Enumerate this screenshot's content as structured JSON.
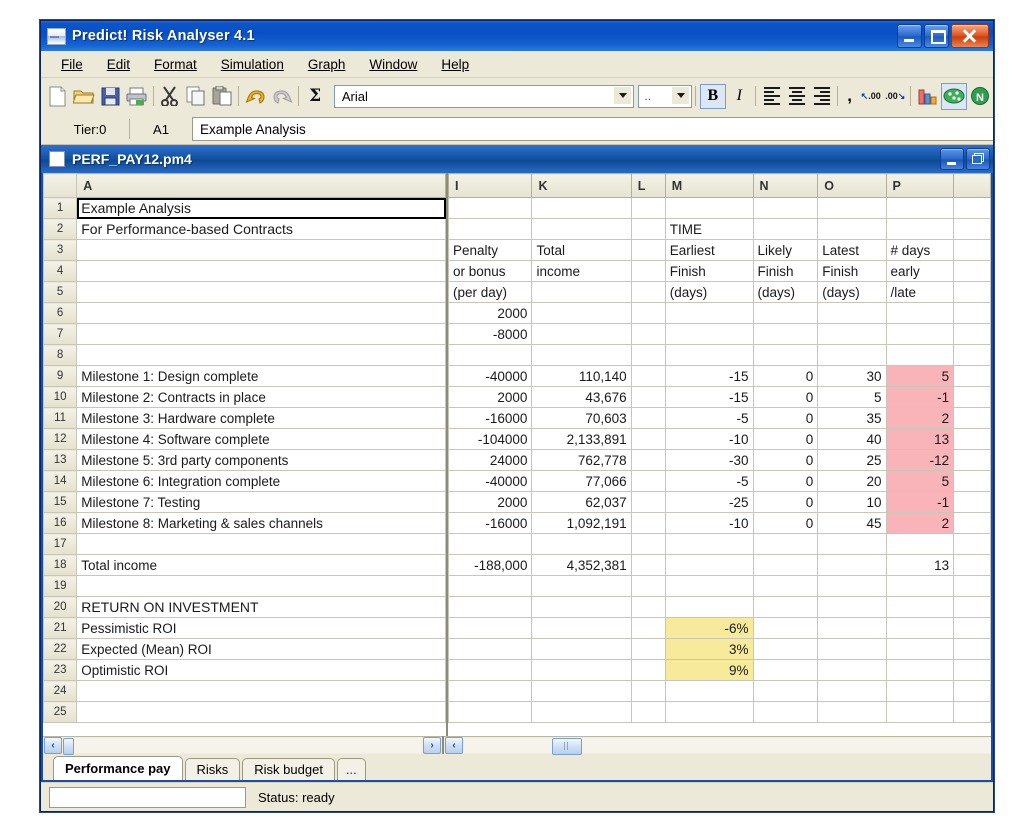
{
  "window": {
    "title": "Predict! Risk Analyser 4.1",
    "icon": "app-icon",
    "minimize": "minimize",
    "maximize": "maximize",
    "close": "close"
  },
  "menu": [
    "File",
    "Edit",
    "Format",
    "Simulation",
    "Graph",
    "Window",
    "Help"
  ],
  "toolbar": {
    "icons": [
      "new-icon",
      "open-icon",
      "save-icon",
      "print-icon",
      "cut-icon",
      "copy-icon",
      "paste-icon",
      "undo-icon",
      "redo-icon",
      "sum-icon"
    ],
    "font_name": "Arial",
    "font_size": "..",
    "bold": "B",
    "italic": "I",
    "comma": ",",
    "inc_dec": ".00",
    "dec_dec": ".00",
    "right_icons": [
      "chart-icon",
      "simulate-icon",
      "n-icon"
    ]
  },
  "formula_bar": {
    "tier": "Tier:0",
    "cell_ref": "A1",
    "value": "Example Analysis",
    "placeholder": ""
  },
  "document": {
    "title": "PERF_PAY12.pm4",
    "minimize": "minimize",
    "restore": "restore"
  },
  "sheet": {
    "columns_left": [
      "A"
    ],
    "columns_right": [
      "I",
      "K",
      "L",
      "M",
      "N",
      "O",
      "P"
    ],
    "row_numbers": [
      "1",
      "2",
      "3",
      "4",
      "5",
      "6",
      "7",
      "8",
      "9",
      "10",
      "11",
      "12",
      "13",
      "14",
      "15",
      "16",
      "17",
      "18",
      "19",
      "20",
      "21",
      "22",
      "23",
      "24",
      "25"
    ],
    "column_A": [
      "Example Analysis",
      "For Performance-based Contracts",
      "",
      "",
      "",
      "",
      "",
      "",
      "Milestone 1:  Design complete",
      "Milestone 2:  Contracts in place",
      "Milestone 3:  Hardware complete",
      "Milestone 4:  Software complete",
      "Milestone 5:  3rd party components",
      "Milestone 6:  Integration complete",
      "Milestone 7:  Testing",
      "Milestone 8:  Marketing & sales channels",
      "",
      "Total income",
      "",
      "RETURN ON INVESTMENT",
      "Pessimistic ROI",
      "Expected (Mean) ROI",
      "Optimistic ROI",
      "",
      ""
    ],
    "column_I": [
      "",
      "",
      "Penalty",
      "or bonus",
      "(per day)",
      "2000",
      "-8000",
      "",
      "-40000",
      "2000",
      "-16000",
      "-104000",
      "24000",
      "-40000",
      "2000",
      "-16000",
      "",
      "-188,000",
      "",
      "",
      "",
      "",
      "",
      "",
      ""
    ],
    "column_K": [
      "",
      "",
      "Total",
      "income",
      "",
      "",
      "",
      "",
      "110,140",
      "43,676",
      "70,603",
      "2,133,891",
      "762,778",
      "77,066",
      "62,037",
      "1,092,191",
      "",
      "4,352,381",
      "",
      "",
      "",
      "",
      "",
      "",
      ""
    ],
    "column_L": [
      "",
      "",
      "",
      "",
      "",
      "",
      "",
      "",
      "",
      "",
      "",
      "",
      "",
      "",
      "",
      "",
      "",
      "",
      "",
      "",
      "",
      "",
      "",
      "",
      ""
    ],
    "column_M": [
      "",
      "TIME",
      "Earliest",
      "Finish",
      "(days)",
      "",
      "",
      "",
      "-15",
      "-15",
      "-5",
      "-10",
      "-30",
      "-5",
      "-25",
      "-10",
      "",
      "",
      "",
      "",
      "-6%",
      "3%",
      "9%",
      "",
      ""
    ],
    "column_N": [
      "",
      "",
      "Likely",
      "Finish",
      "(days)",
      "",
      "",
      "",
      "0",
      "0",
      "0",
      "0",
      "0",
      "0",
      "0",
      "0",
      "",
      "",
      "",
      "",
      "",
      "",
      "",
      "",
      ""
    ],
    "column_O": [
      "",
      "",
      "Latest",
      "Finish",
      "(days)",
      "",
      "",
      "",
      "30",
      "5",
      "35",
      "40",
      "25",
      "20",
      "10",
      "45",
      "",
      "",
      "",
      "",
      "",
      "",
      "",
      "",
      ""
    ],
    "column_P": [
      "",
      "",
      "# days",
      "early",
      "/late",
      "",
      "",
      "",
      "5",
      "-1",
      "2",
      "13",
      "-12",
      "5",
      "-1",
      "2",
      "",
      "13",
      "",
      "",
      "",
      "",
      "",
      "",
      ""
    ],
    "bold_rows_A": [
      1,
      2,
      20
    ],
    "selected_cell": "A1",
    "pink_cells_P": [
      9,
      10,
      11,
      12,
      13,
      14,
      15,
      16
    ],
    "yellow_cells_M": [
      21,
      22,
      23
    ]
  },
  "tabs": [
    {
      "label": "Performance pay",
      "active": true
    },
    {
      "label": "Risks",
      "active": false
    },
    {
      "label": "Risk budget",
      "active": false
    },
    {
      "label": "...",
      "active": false
    }
  ],
  "status": {
    "field_value": "",
    "text": "Status: ready"
  },
  "colors": {
    "titlebar": "#0a54c9",
    "chrome": "#ece9d8",
    "pink_highlight": "#f8b4b8",
    "yellow_highlight": "#f7eb9b",
    "grid_line": "#c8c6b8"
  }
}
